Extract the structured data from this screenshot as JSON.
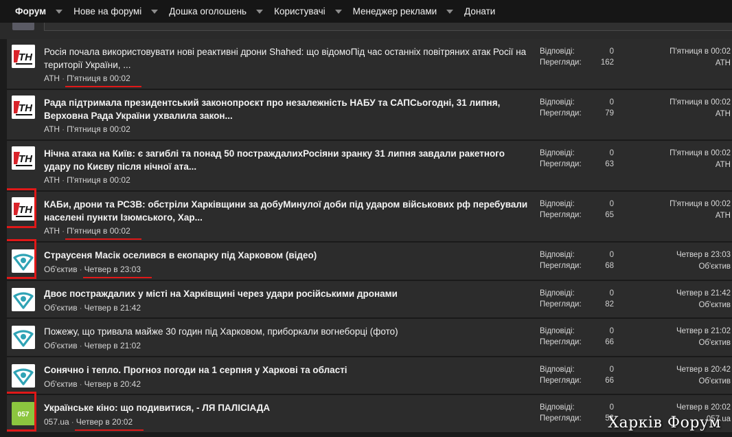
{
  "nav": {
    "items": [
      {
        "label": "Форум",
        "active": true,
        "dropdown": true
      },
      {
        "label": "Нове на форумі",
        "active": false,
        "dropdown": true
      },
      {
        "label": "Дошка оголошень",
        "active": false,
        "dropdown": true
      },
      {
        "label": "Користувачі",
        "active": false,
        "dropdown": true
      },
      {
        "label": "Менеджер реклами",
        "active": false,
        "dropdown": true
      },
      {
        "label": "Донати",
        "active": false,
        "dropdown": false
      }
    ]
  },
  "labels": {
    "replies": "Відповіді:",
    "views": "Перегляди:"
  },
  "threads": [
    {
      "title": "Росія почала використовувати нові реактивні дрони Shahed: що відомоПід час останніх повітряних атак Росії на території України, ...",
      "bold": false,
      "author": "АТН",
      "date": "П'ятниця в 00:02",
      "replies": "0",
      "views": "162",
      "last_date": "П'ятниця в 00:02",
      "last_author": "АТН",
      "avatar": "atn-logo-icon"
    },
    {
      "title": "Рада підтримала президентський законопроєкт про незалежність НАБУ та САПСьогодні, 31 липня, Верховна Рада України ухвалила закон...",
      "bold": true,
      "author": "АТН",
      "date": "П'ятниця в 00:02",
      "replies": "0",
      "views": "79",
      "last_date": "П'ятниця в 00:02",
      "last_author": "АТН",
      "avatar": "atn-logo-icon"
    },
    {
      "title": "Нічна атака на Київ: є загиблі та понад 50 постраждалихРосіяни зранку 31 липня завдали ракетного удару по Києву після нічної ата...",
      "bold": true,
      "author": "АТН",
      "date": "П'ятниця в 00:02",
      "replies": "0",
      "views": "63",
      "last_date": "П'ятниця в 00:02",
      "last_author": "АТН",
      "avatar": "atn-logo-icon"
    },
    {
      "title": "КАБи, дрони та РСЗВ: обстріли Харківщини за добуМинулої доби під ударом військових рф перебували населені пункти Ізюмського, Хар...",
      "bold": true,
      "author": "АТН",
      "date": "П'ятниця в 00:02",
      "replies": "0",
      "views": "65",
      "last_date": "П'ятниця в 00:02",
      "last_author": "АТН",
      "avatar": "atn-logo-icon"
    },
    {
      "title": "Страусеня Масік оселився в екопарку під Харковом (відео)",
      "bold": true,
      "author": "Об'єктив",
      "date": "Четвер в 23:03",
      "replies": "0",
      "views": "68",
      "last_date": "Четвер в 23:03",
      "last_author": "Об'єктив",
      "avatar": "obiektyv-logo-icon"
    },
    {
      "title": "Двоє постраждалих у місті на Харківщині через удари російськими дронами",
      "bold": true,
      "author": "Об'єктив",
      "date": "Четвер в 21:42",
      "replies": "0",
      "views": "82",
      "last_date": "Четвер в 21:42",
      "last_author": "Об'єктив",
      "avatar": "obiektyv-logo-icon"
    },
    {
      "title": "Пожежу, що тривала майже 30 годин під Харковом, приборкали вогнеборці (фото)",
      "bold": false,
      "author": "Об'єктив",
      "date": "Четвер в 21:02",
      "replies": "0",
      "views": "66",
      "last_date": "Четвер в 21:02",
      "last_author": "Об'єктив",
      "avatar": "obiektyv-logo-icon"
    },
    {
      "title": "Сонячно і тепло. Прогноз погоди на 1 серпня у Харкові та області",
      "bold": true,
      "author": "Об'єктив",
      "date": "Четвер в 20:42",
      "replies": "0",
      "views": "66",
      "last_date": "Четвер в 20:42",
      "last_author": "Об'єктив",
      "avatar": "obiektyv-logo-icon"
    },
    {
      "title": "Українське кіно: що подивитися, - ЛЯ ПАЛІСІАДА",
      "bold": true,
      "author": "057.ua",
      "date": "Четвер в 20:02",
      "replies": "0",
      "views": "52",
      "last_date": "Четвер в 20:02",
      "last_author": "057.ua",
      "avatar": "057-logo-icon"
    }
  ],
  "logo_057_text": "057",
  "watermark": "Харків Форум",
  "colors": {
    "highlight": "#e01818",
    "atn_red": "#d9232a",
    "obiektyv_teal": "#2fa3b5",
    "logo_057_green": "#8cc63f"
  }
}
